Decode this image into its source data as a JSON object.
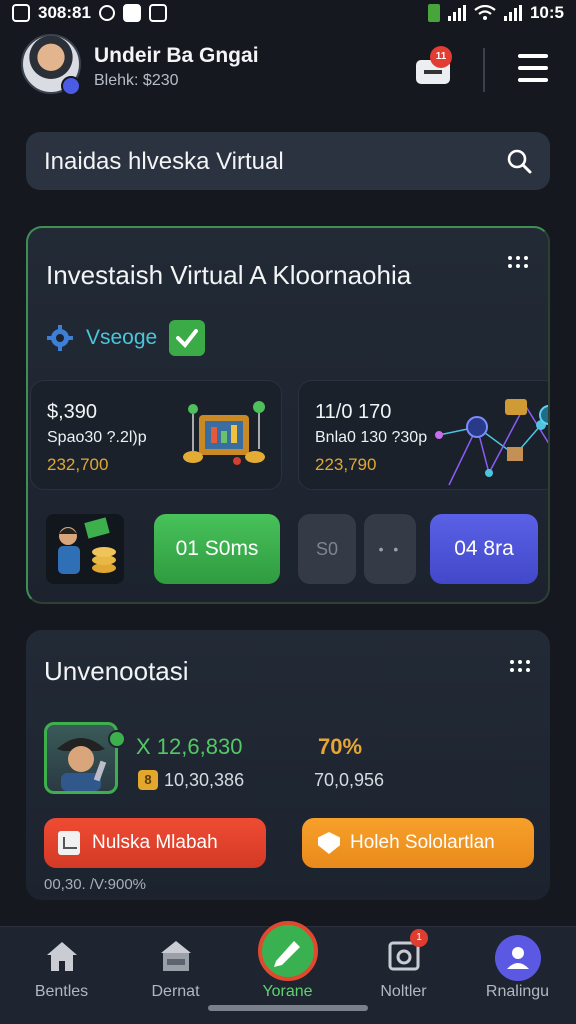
{
  "status_bar": {
    "left_text": "308:81",
    "time": "10:5"
  },
  "header": {
    "user_name": "Undeir Ba Gngai",
    "user_balance": "Blehk: $230",
    "notification_count": "11"
  },
  "search": {
    "text": "Inaidas hlveska Virtual"
  },
  "investment_card": {
    "title": "Investaish Virtual A Kloornaohia",
    "tag_label": "Vseoge",
    "stats": [
      {
        "value": "$,390",
        "sub": "Spao30 ?.2l)p",
        "amount": "232,700"
      },
      {
        "value": "11/0 170",
        "sub": "Bnla0 130 ?30p",
        "amount": "223,790"
      }
    ],
    "actions": {
      "green_label": "01 S0ms",
      "gray_1_label": "S0",
      "gray_2_label": "• •",
      "blue_label": "04 8ra"
    }
  },
  "summary_card": {
    "title": "Unvenootasi",
    "main_value": "X 12,6,830",
    "percent_value": "70%",
    "sub_value_1": "10,30,386",
    "sub_value_2": "70,0,956",
    "coin_symbol": "8",
    "button_red_label": "Nulska Mlabah",
    "button_orange_label": "Holeh Sololartlan",
    "footer_note": "00,30. /V:900%"
  },
  "bottom_nav": {
    "items": [
      {
        "label": "Bentles",
        "icon": "house-icon"
      },
      {
        "label": "Dernat",
        "icon": "store-icon"
      },
      {
        "label": "Yorane",
        "icon": "edit-icon"
      },
      {
        "label": "Noltler",
        "icon": "notification-icon",
        "badge": "1"
      },
      {
        "label": "Rnalingu",
        "icon": "profile-icon"
      }
    ]
  },
  "colors": {
    "background": "#15191f",
    "card": "#222a36",
    "green": "#3db04d",
    "blue": "#4b52d6",
    "orange": "#f39a26",
    "red": "#e5432e",
    "gold": "#e0a832"
  }
}
